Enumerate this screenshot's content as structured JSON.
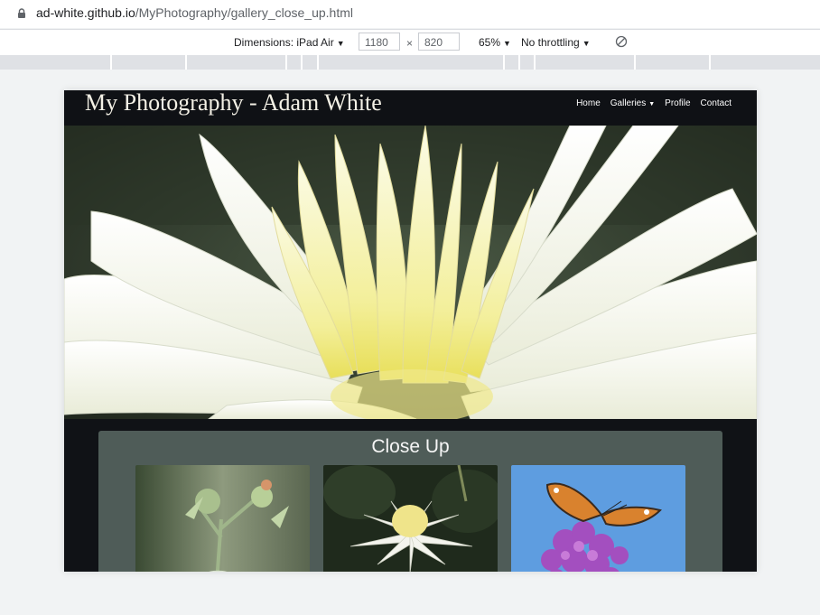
{
  "browser": {
    "url_host": "ad-white.github.io",
    "url_path": "/MyPhotography/gallery_close_up.html"
  },
  "devtools": {
    "dimensions_label": "Dimensions: iPad Air",
    "width_value": "1180",
    "times_symbol": "×",
    "height_value": "820",
    "zoom_label": "65%",
    "throttling_label": "No throttling"
  },
  "site": {
    "brand": "My Photography - Adam White",
    "nav": {
      "home": "Home",
      "galleries": "Galleries",
      "profile": "Profile",
      "contact": "Contact"
    },
    "gallery_title": "Close Up"
  },
  "colors": {
    "site_background": "#101216",
    "panel": "#4f5c58",
    "brand_text": "#f4f1e6"
  }
}
